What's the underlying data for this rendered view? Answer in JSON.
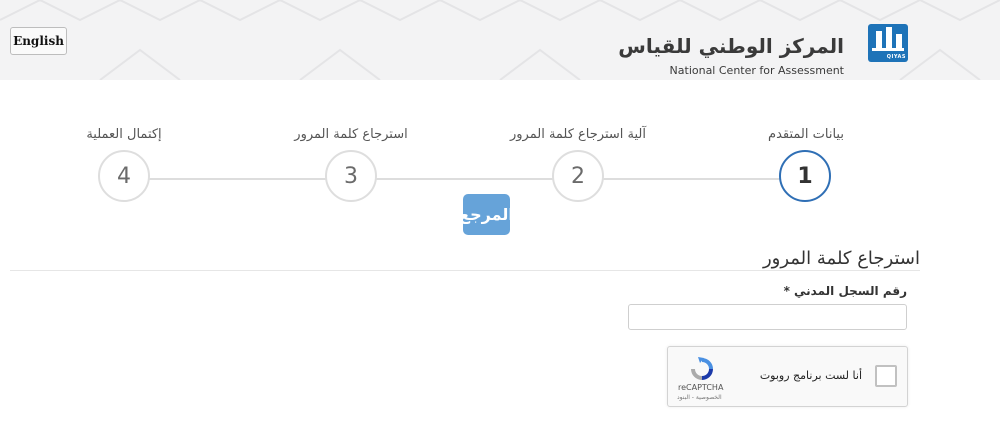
{
  "header": {
    "language_button": "English",
    "logo_arabic": "المركز الوطني للقياس",
    "logo_english": "National Center for Assessment",
    "logo_mark_label": "QIYAS"
  },
  "steps": [
    {
      "number": "1",
      "label": "بيانات المتقدم",
      "active": true
    },
    {
      "number": "2",
      "label": "آلية استرجاع كلمة المرور",
      "active": false
    },
    {
      "number": "3",
      "label": "استرجاع كلمة المرور",
      "active": false
    },
    {
      "number": "4",
      "label": "إكتمال العملية",
      "active": false
    }
  ],
  "watermark": "المرجع",
  "form": {
    "section_title": "استرجاع كلمة المرور",
    "civil_id_label": "رقم السجل المدني",
    "required_mark": "*",
    "civil_id_value": "",
    "civil_id_placeholder": ""
  },
  "captcha": {
    "label": "أنا لست برنامج روبوت",
    "brand": "reCAPTCHA",
    "links": "الخصوصية - البنود"
  },
  "colors": {
    "accent": "#2f6fb5",
    "header_bg": "#f3f3f4",
    "watermark_bg": "#66a3d9"
  }
}
